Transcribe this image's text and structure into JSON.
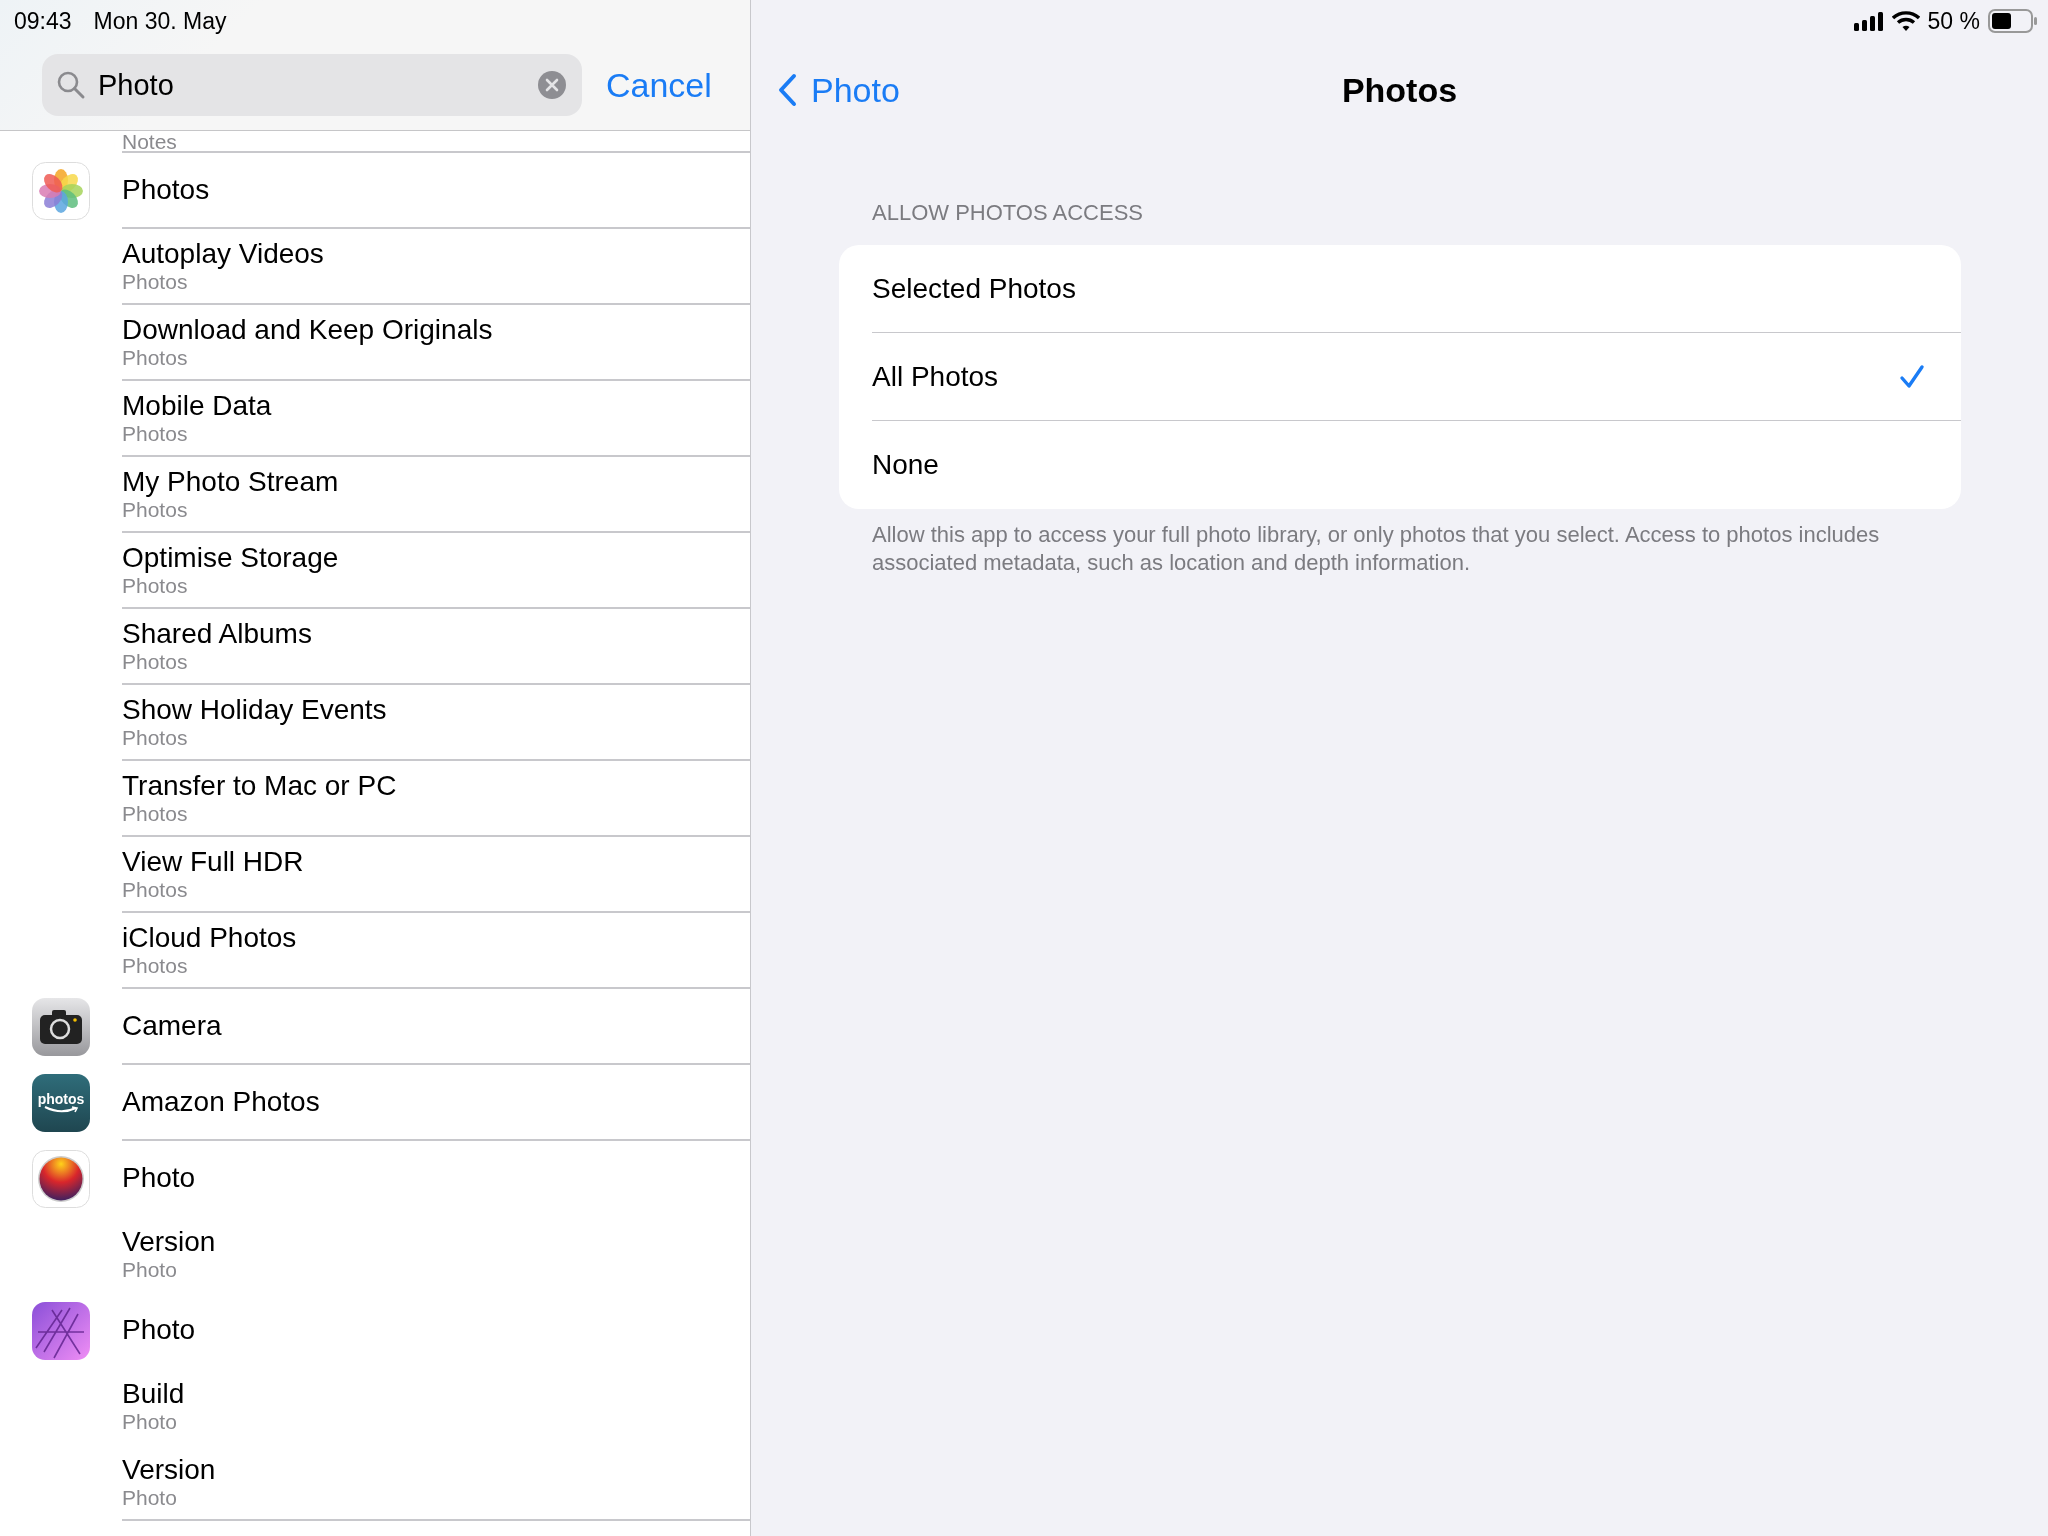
{
  "status_bar": {
    "time": "09:43",
    "date": "Mon 30. May",
    "battery_text": "50 %"
  },
  "search": {
    "value": "Photo",
    "cancel": "Cancel"
  },
  "results": [
    {
      "kind": "partial",
      "subtitle": "Notes",
      "divider": true
    },
    {
      "title": "Photos",
      "icon": {
        "kind": "flower"
      },
      "divider": true
    },
    {
      "title": "Autoplay Videos",
      "subtitle": "Photos",
      "divider": true
    },
    {
      "title": "Download and Keep Originals",
      "subtitle": "Photos",
      "divider": true
    },
    {
      "title": "Mobile Data",
      "subtitle": "Photos",
      "divider": true
    },
    {
      "title": "My Photo Stream",
      "subtitle": "Photos",
      "divider": true
    },
    {
      "title": "Optimise Storage",
      "subtitle": "Photos",
      "divider": true
    },
    {
      "title": "Shared Albums",
      "subtitle": "Photos",
      "divider": true
    },
    {
      "title": "Show Holiday Events",
      "subtitle": "Photos",
      "divider": true
    },
    {
      "title": "Transfer to Mac or PC",
      "subtitle": "Photos",
      "divider": true
    },
    {
      "title": "View Full HDR",
      "subtitle": "Photos",
      "divider": true
    },
    {
      "title": "iCloud Photos",
      "subtitle": "Photos",
      "divider": true
    },
    {
      "title": "Camera",
      "icon": {
        "kind": "camera"
      },
      "divider": true
    },
    {
      "title": "Amazon Photos",
      "icon": {
        "kind": "amazon",
        "text": "photos"
      },
      "divider": true
    },
    {
      "title": "Photo",
      "icon": {
        "kind": "orb"
      },
      "divider": false
    },
    {
      "title": "Version",
      "subtitle": "Photo",
      "divider": false
    },
    {
      "title": "Photo",
      "icon": {
        "kind": "aperture"
      },
      "divider": false
    },
    {
      "title": "Build",
      "subtitle": "Photo",
      "divider": false
    },
    {
      "title": "Version",
      "subtitle": "Photo",
      "divider": true
    }
  ],
  "detail": {
    "back": "Photo",
    "title": "Photos",
    "section_header": "ALLOW PHOTOS ACCESS",
    "options": [
      {
        "label": "Selected Photos",
        "selected": false
      },
      {
        "label": "All Photos",
        "selected": true
      },
      {
        "label": "None",
        "selected": false
      }
    ],
    "footer": "Allow this app to access your full photo library, or only photos that you select. Access to photos includes associated metadata, such as location and depth information."
  }
}
